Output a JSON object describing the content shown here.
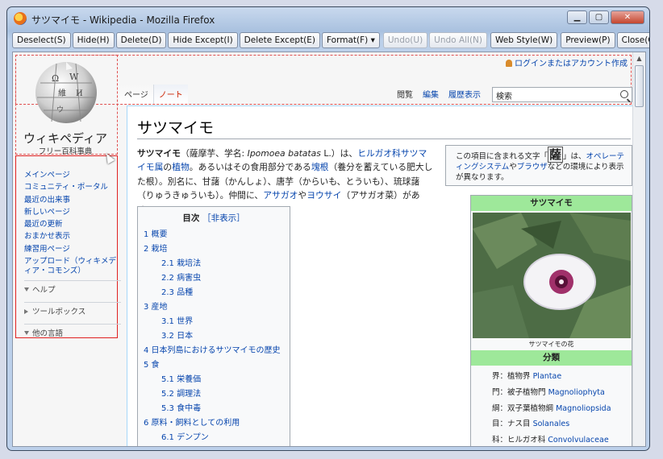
{
  "window": {
    "title": "サツマイモ - Wikipedia - Mozilla Firefox",
    "controls": {
      "minimize": "▁",
      "maximize": "▢",
      "close": "✕"
    }
  },
  "toolbar": {
    "buttons": [
      {
        "label": "Deselect(S)",
        "enabled": true
      },
      {
        "label": "Hide(H)",
        "enabled": true
      },
      {
        "label": "Delete(D)",
        "enabled": true
      },
      {
        "label": "Hide Except(I)",
        "enabled": true
      },
      {
        "label": "Delete Except(E)",
        "enabled": true
      },
      {
        "label": "Format(F) ▾",
        "enabled": true
      },
      {
        "label": "Undo(U)",
        "enabled": false
      },
      {
        "label": "Undo All(N)",
        "enabled": false
      },
      {
        "label": "Web Style(W)",
        "enabled": true
      },
      {
        "label": "Preview(P)",
        "enabled": true
      },
      {
        "label": "Close(C)",
        "enabled": true
      }
    ]
  },
  "header": {
    "login": "ログインまたはアカウント作成",
    "site_name": "ウィキペディア",
    "tagline": "フリー百科事典",
    "tabs_left": [
      "ページ",
      "ノート"
    ],
    "tabs_right": [
      "閲覧",
      "編集",
      "履歴表示"
    ],
    "search_value": "検索"
  },
  "nav": {
    "links": [
      "メインページ",
      "コミュニティ・ポータル",
      "最近の出来事",
      "新しいページ",
      "最近の更新",
      "おまかせ表示",
      "練習用ページ",
      "アップロード（ウィキメディア・コモンズ）"
    ],
    "sections": [
      "ヘルプ",
      "ツールボックス",
      "他の言語"
    ]
  },
  "article": {
    "title": "サツマイモ",
    "notice": {
      "pre": "この項目に含まれる文字「",
      "char": "薩",
      "mid": "」は、",
      "link1": "オペレーティングシステム",
      "and": "や",
      "link2": "ブラウザ",
      "post": "などの環境により表示が異なります。"
    },
    "intro": {
      "bold": "サツマイモ",
      "t1": "（薩摩芋、学名: ",
      "latin": "Ipomoea batatas",
      "t2": " L.）は、",
      "l1": "ヒルガオ科サツマイモ属",
      "t3": "の",
      "l2": "植物",
      "t4": "。あるいはその食用部分である",
      "l3": "塊根",
      "t5": "（養分を蓄えている肥大した根）。別名に、甘藷（かんしょ）、唐芋（からいも、とういも）、琉球藷（りゅうきゅういも）。仲間に、",
      "l4": "アサガオ",
      "t6": "や",
      "l5": "ヨウサイ",
      "t7": "（アサガオ菜）がある。"
    },
    "toc": {
      "title": "目次",
      "toggle": "［非表示］",
      "items": [
        {
          "text": "1 概要",
          "level": 1
        },
        {
          "text": "2 栽培",
          "level": 1
        },
        {
          "text": "2.1 栽培法",
          "level": 2
        },
        {
          "text": "2.2 病害虫",
          "level": 2
        },
        {
          "text": "2.3 品種",
          "level": 2
        },
        {
          "text": "3 産地",
          "level": 1
        },
        {
          "text": "3.1 世界",
          "level": 2
        },
        {
          "text": "3.2 日本",
          "level": 2
        },
        {
          "text": "4 日本列島におけるサツマイモの歴史",
          "level": 1
        },
        {
          "text": "5 食",
          "level": 1
        },
        {
          "text": "5.1 栄養価",
          "level": 2
        },
        {
          "text": "5.2 調理法",
          "level": 2
        },
        {
          "text": "5.3 食中毒",
          "level": 2
        },
        {
          "text": "6 原料・飼料としての利用",
          "level": 1
        },
        {
          "text": "6.1 デンプン",
          "level": 2
        }
      ]
    },
    "infobox": {
      "title": "サツマイモ",
      "caption": "サツマイモの花",
      "section": "分類",
      "rows": [
        {
          "rank": "界",
          "name": "植物界",
          "latin": "Plantae"
        },
        {
          "rank": "門",
          "name": "被子植物門",
          "latin": "Magnoliophyta"
        },
        {
          "rank": "綱",
          "name": "双子葉植物綱",
          "latin": "Magnoliopsida"
        },
        {
          "rank": "目",
          "name": "ナス目",
          "latin": "Solanales"
        },
        {
          "rank": "科",
          "name": "ヒルガオ科",
          "latin": "Convolvulaceae"
        }
      ]
    }
  }
}
